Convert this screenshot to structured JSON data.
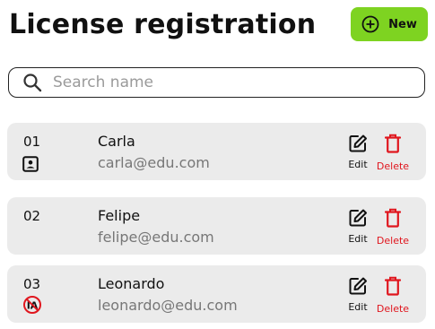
{
  "header": {
    "title": "License registration",
    "new_button_label": "New"
  },
  "search": {
    "placeholder": "Search name",
    "value": ""
  },
  "actions": {
    "edit_label": "Edit",
    "delete_label": "Delete"
  },
  "colors": {
    "accent_green": "#7ed321",
    "delete_red": "#e0161e",
    "card_bg": "#ebebeb"
  },
  "records": [
    {
      "id": "01",
      "name": "Carla",
      "email": "carla@edu.com",
      "status_icon": "id-card-icon"
    },
    {
      "id": "02",
      "name": "Felipe",
      "email": "felipe@edu.com",
      "status_icon": ""
    },
    {
      "id": "03",
      "name": "Leonardo",
      "email": "leonardo@edu.com",
      "status_icon": "no-ia-icon"
    }
  ]
}
